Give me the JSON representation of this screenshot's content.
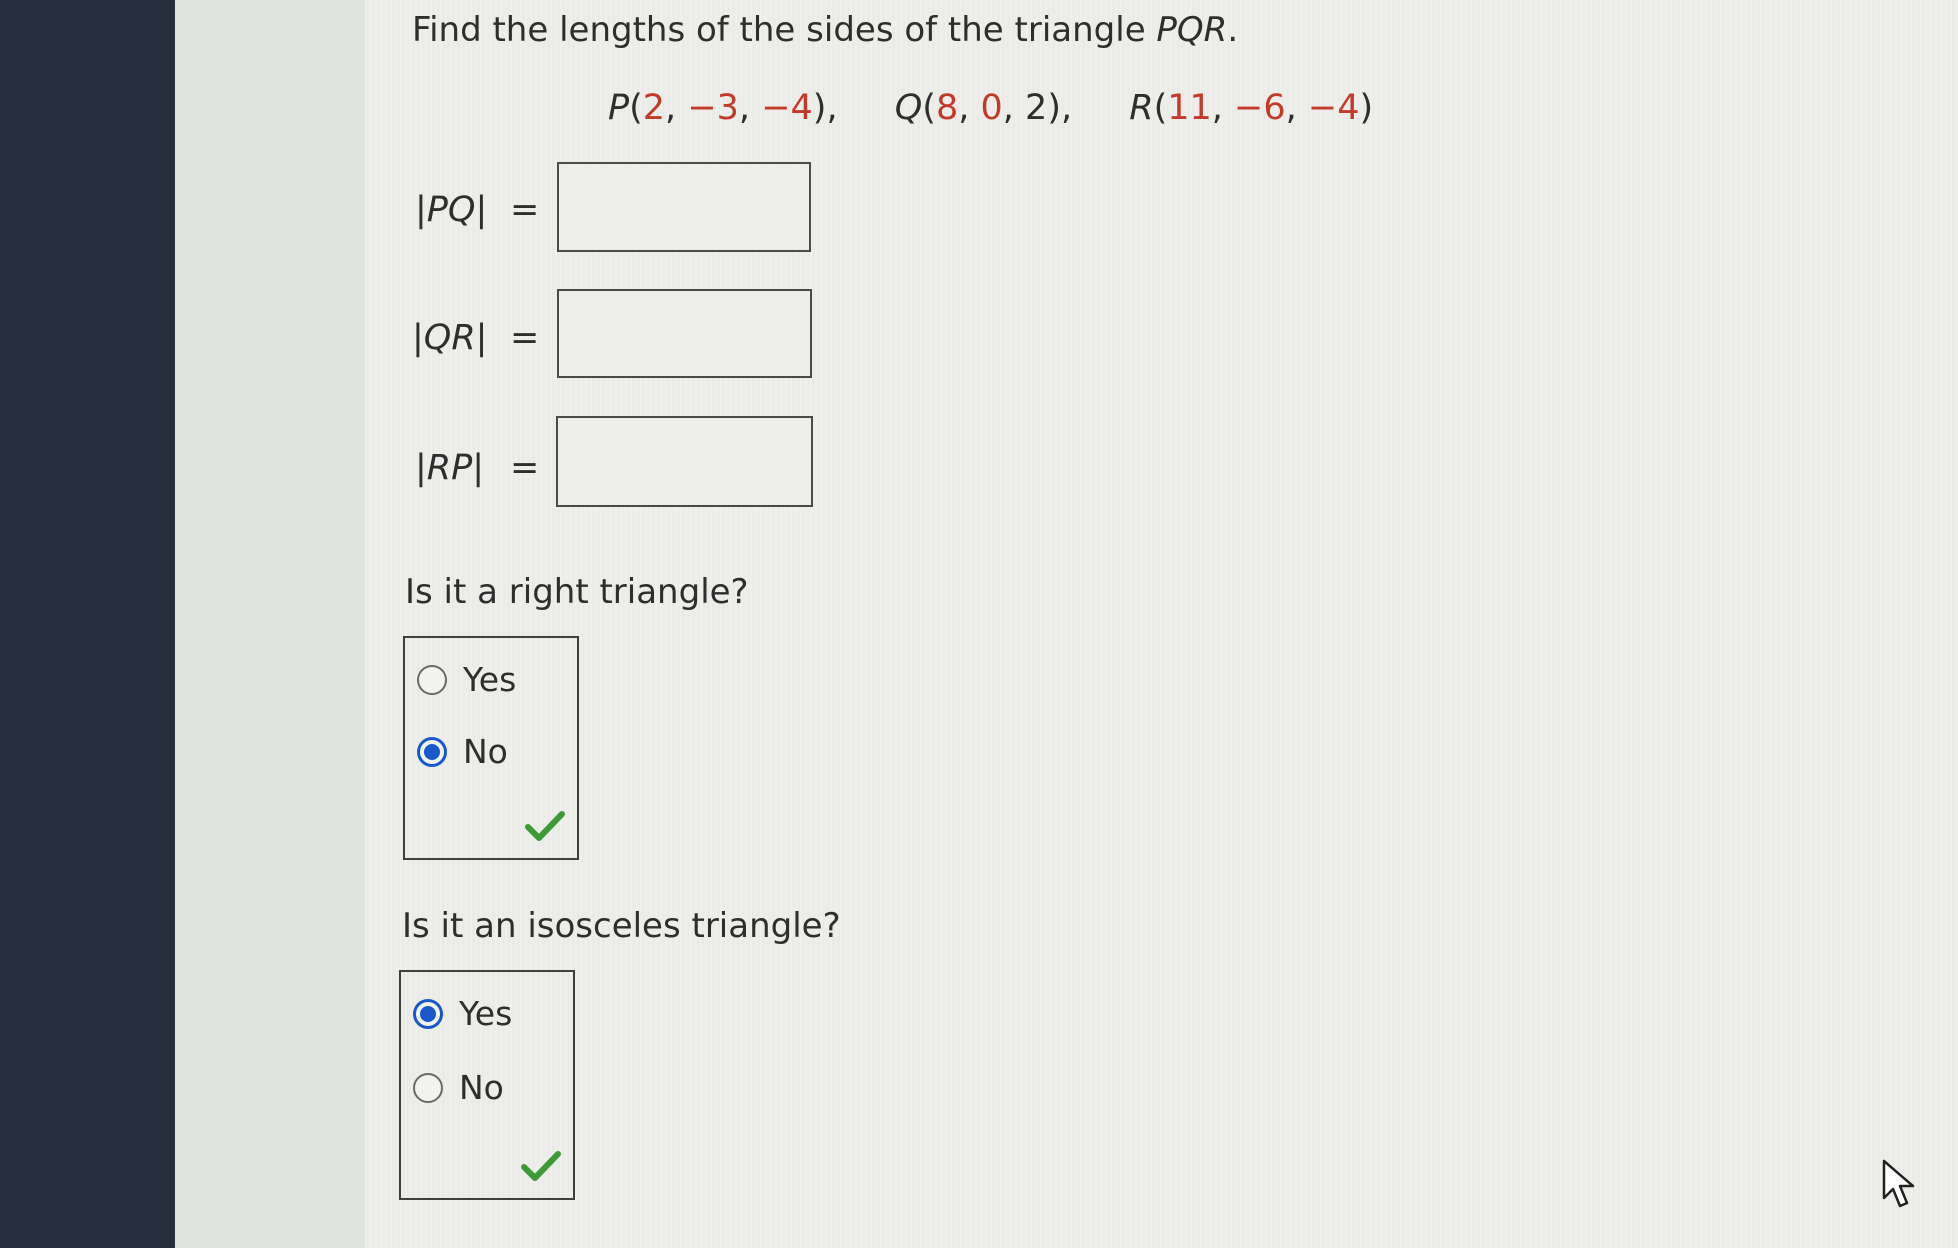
{
  "question": {
    "prefix": "Find the lengths of the sides of the triangle ",
    "name": "PQR",
    "suffix": "."
  },
  "points": {
    "P": {
      "label": "P",
      "open": "(",
      "x": "2",
      "y": "−3",
      "z": "−4",
      "close": "),"
    },
    "Q": {
      "label": "Q",
      "open": "(",
      "x": "8",
      "y": "0",
      "z": "2",
      "close": "),"
    },
    "R": {
      "label": "R",
      "open": "(",
      "x": "11",
      "y": "−6",
      "z": "−4",
      "close": ")"
    }
  },
  "lengths": [
    {
      "bar_open": "|",
      "name": "PQ",
      "bar_close": "|",
      "equals": "=",
      "value": ""
    },
    {
      "bar_open": "|",
      "name": "QR",
      "bar_close": "|",
      "equals": "=",
      "value": ""
    },
    {
      "bar_open": "|",
      "name": "RP",
      "bar_close": "|",
      "equals": "=",
      "value": ""
    }
  ],
  "right_triangle": {
    "heading": "Is it a right triangle?",
    "options": [
      "Yes",
      "No"
    ],
    "selected": "No",
    "status": "correct"
  },
  "isosceles_triangle": {
    "heading": "Is it an isosceles triangle?",
    "options": [
      "Yes",
      "No"
    ],
    "selected": "Yes",
    "status": "correct"
  },
  "colors": {
    "sidebar": "#262e3b",
    "value_highlight": "#c43a2a",
    "radio_selected": "#1a59c9",
    "check_mark": "#3d9a36"
  },
  "icons": [
    "radio-icon",
    "checkmark-icon",
    "cursor-icon"
  ]
}
